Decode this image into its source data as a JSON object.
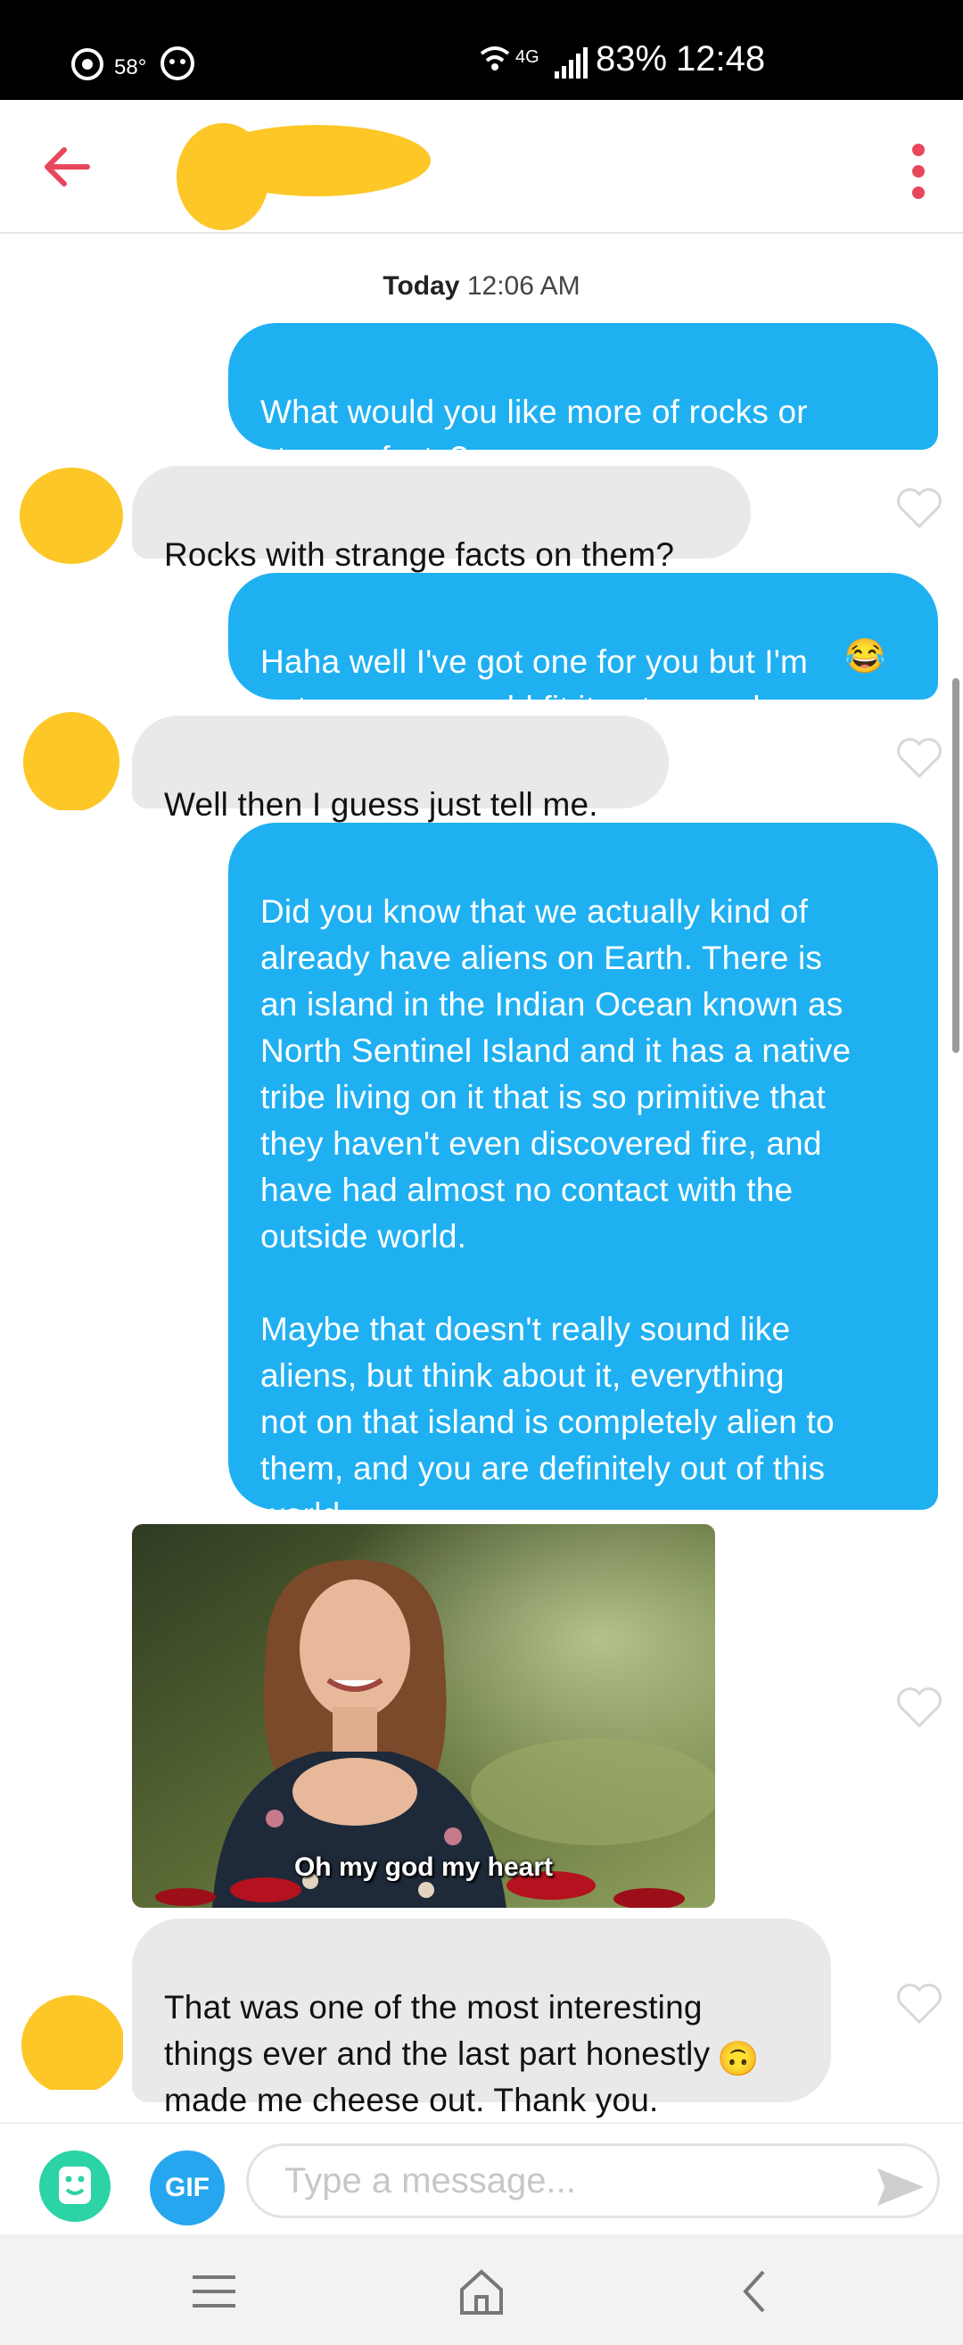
{
  "status_bar": {
    "temperature": "58°",
    "network": "4G",
    "battery": "83%",
    "time": "12:48"
  },
  "header": {
    "back_icon": "arrow-left-icon",
    "menu_icon": "more-vertical-icon",
    "accent_color": "#e8475b"
  },
  "conversation": {
    "date_day": "Today",
    "date_time": "12:06 AM",
    "messages": [
      {
        "from": "me",
        "text": "What would you like more of rocks or\nstrange fscts?"
      },
      {
        "from": "them",
        "text": "Rocks with strange facts on them?"
      },
      {
        "from": "me",
        "text": "Haha well I've got one for you but I'm\nnot sure you could fit it onto a rock",
        "emoji": "😂"
      },
      {
        "from": "them",
        "text": "Well then I guess just tell me."
      },
      {
        "from": "me",
        "text": "Did you know that we actually kind of\nalready have aliens on Earth. There is\nan island in the Indian Ocean known as\nNorth Sentinel Island and it has a native\ntribe living on it that is so primitive that\nthey haven't even discovered fire, and\nhave had almost no contact with the\noutside world.\n\nMaybe that doesn't really sound like\naliens, but think about it, everything\nnot on that island is completely alien to\nthem, and you are definitely out of this\nworld."
      },
      {
        "from": "them",
        "type": "gif",
        "caption": "Oh my god my heart"
      },
      {
        "from": "them",
        "text": "That was one of the most interesting\nthings ever and the last part honestly\nmade me cheese out. Thank you.",
        "emoji": "🙃"
      }
    ],
    "outgoing_color": "#1fb0f2",
    "incoming_color": "#e9e9e9"
  },
  "input": {
    "placeholder": "Type a message...",
    "gif_label": "GIF",
    "sticker_icon": "sticker-icon",
    "send_icon": "send-icon"
  },
  "nav": {
    "recents_icon": "recents-icon",
    "home_icon": "home-icon",
    "back_icon": "back-icon"
  }
}
